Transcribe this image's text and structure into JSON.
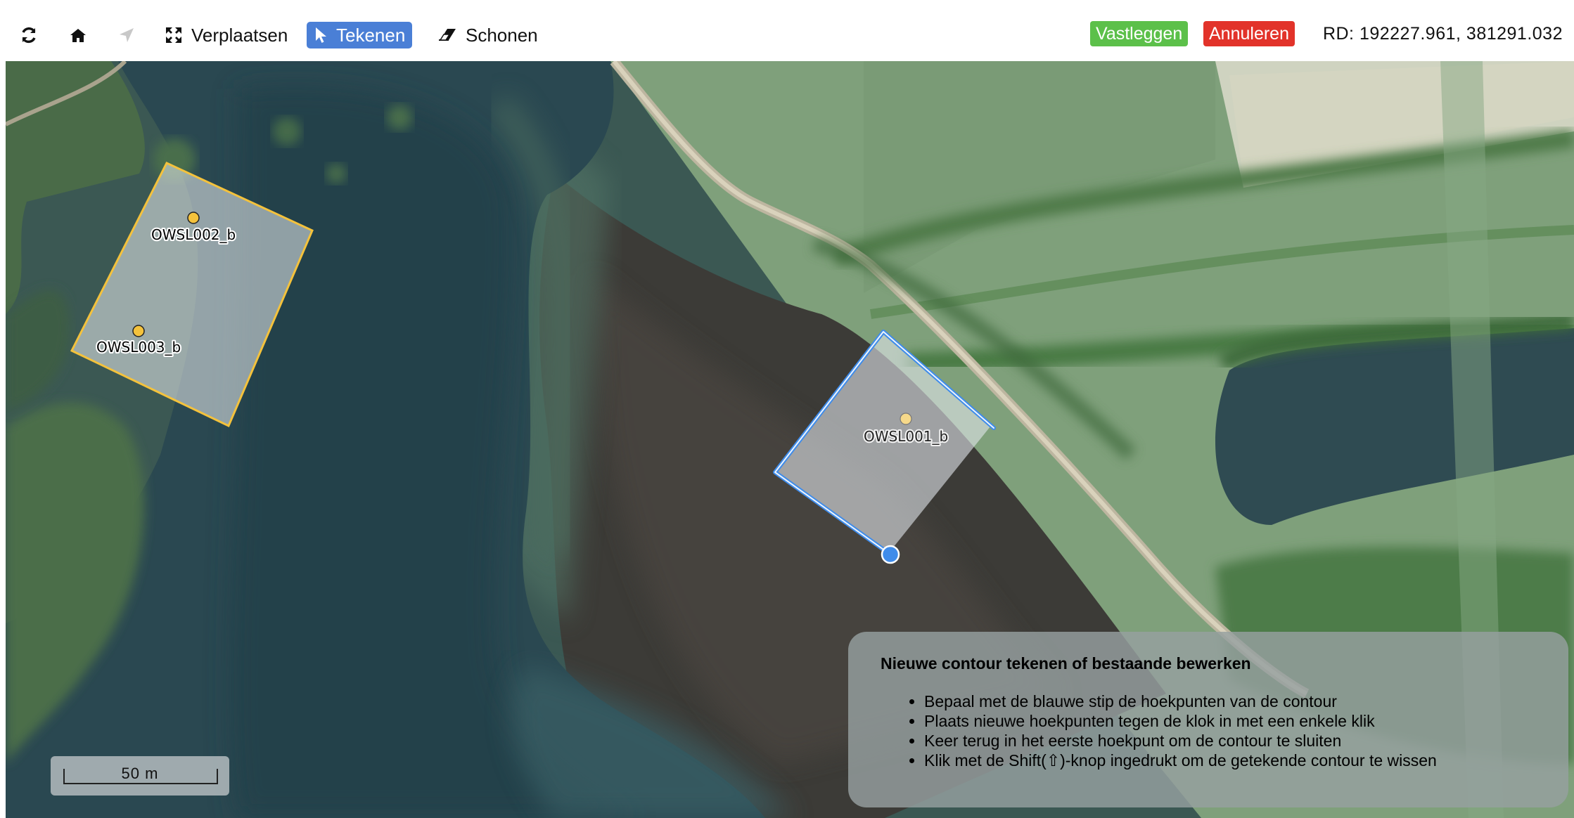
{
  "toolbar": {
    "refresh_icon": "refresh-icon",
    "home_icon": "home-icon",
    "locate_icon": "location-arrow-icon",
    "move_label": "Verplaatsen",
    "draw_label": "Tekenen",
    "clear_label": "Schonen",
    "save_label": "Vastleggen",
    "cancel_label": "Annuleren",
    "coordinates": "RD: 192227.961, 381291.032"
  },
  "colors": {
    "active_tool": "#4a7fd6",
    "save": "#5cc04a",
    "cancel": "#e2332a",
    "existing_contour": "#f4c23c",
    "drawing_contour": "#3f8cea"
  },
  "map": {
    "features": [
      {
        "label": "OWSL002_b"
      },
      {
        "label": "OWSL003_b"
      },
      {
        "label": "OWSL001_b"
      }
    ],
    "scale_label": "50 m"
  },
  "help": {
    "title": "Nieuwe contour tekenen of bestaande bewerken",
    "items": [
      "Bepaal met de blauwe stip de hoekpunten van de contour",
      "Plaats nieuwe hoekpunten tegen de klok in met een enkele klik",
      "Keer terug in het eerste hoekpunt om de contour te sluiten",
      "Klik met de Shift(⇧)-knop ingedrukt om de getekende contour te wissen"
    ]
  }
}
